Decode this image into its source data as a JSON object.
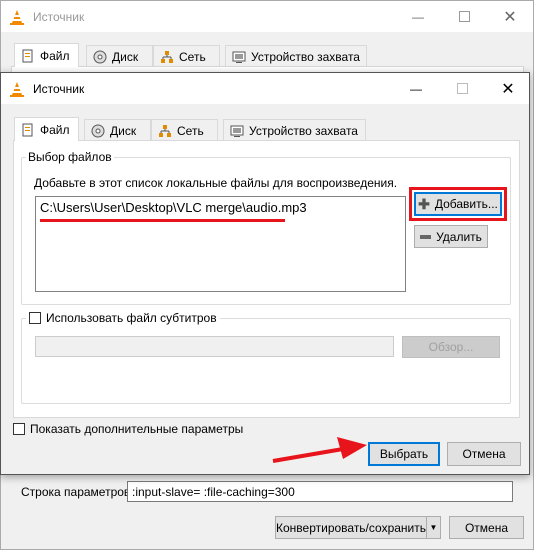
{
  "back_window": {
    "title": "Источник",
    "tabs": [
      {
        "label": "Файл"
      },
      {
        "label": "Диск"
      },
      {
        "label": "Сеть"
      },
      {
        "label": "Устройство захвата"
      }
    ],
    "params_label": "Строка параметров",
    "params_value": ":input-slave= :file-caching=300",
    "convert_label": "Конвертировать/сохранить",
    "cancel_label": "Отмена"
  },
  "front_window": {
    "title": "Источник",
    "tabs": [
      {
        "label": "Файл"
      },
      {
        "label": "Диск"
      },
      {
        "label": "Сеть"
      },
      {
        "label": "Устройство захвата"
      }
    ],
    "files_group_title": "Выбор файлов",
    "files_hint": "Добавьте в этот список локальные файлы для воспроизведения.",
    "file_entries": [
      "C:\\Users\\User\\Desktop\\VLC merge\\audio.mp3"
    ],
    "add_label": "Добавить...",
    "remove_label": "Удалить",
    "subtitle_label": "Использовать файл субтитров",
    "subtitle_path": "",
    "browse_label": "Обзор...",
    "show_more_label": "Показать дополнительные параметры",
    "select_label": "Выбрать",
    "cancel_label": "Отмена"
  },
  "colors": {
    "annotation": "#e8141c",
    "accent": "#0078d7"
  },
  "icons": [
    "vlc-cone-icon",
    "file-icon",
    "disc-icon",
    "network-icon",
    "capture-icon",
    "minimize-icon",
    "maximize-icon",
    "close-icon",
    "plus-icon",
    "minus-icon",
    "dropdown-arrow-icon"
  ]
}
